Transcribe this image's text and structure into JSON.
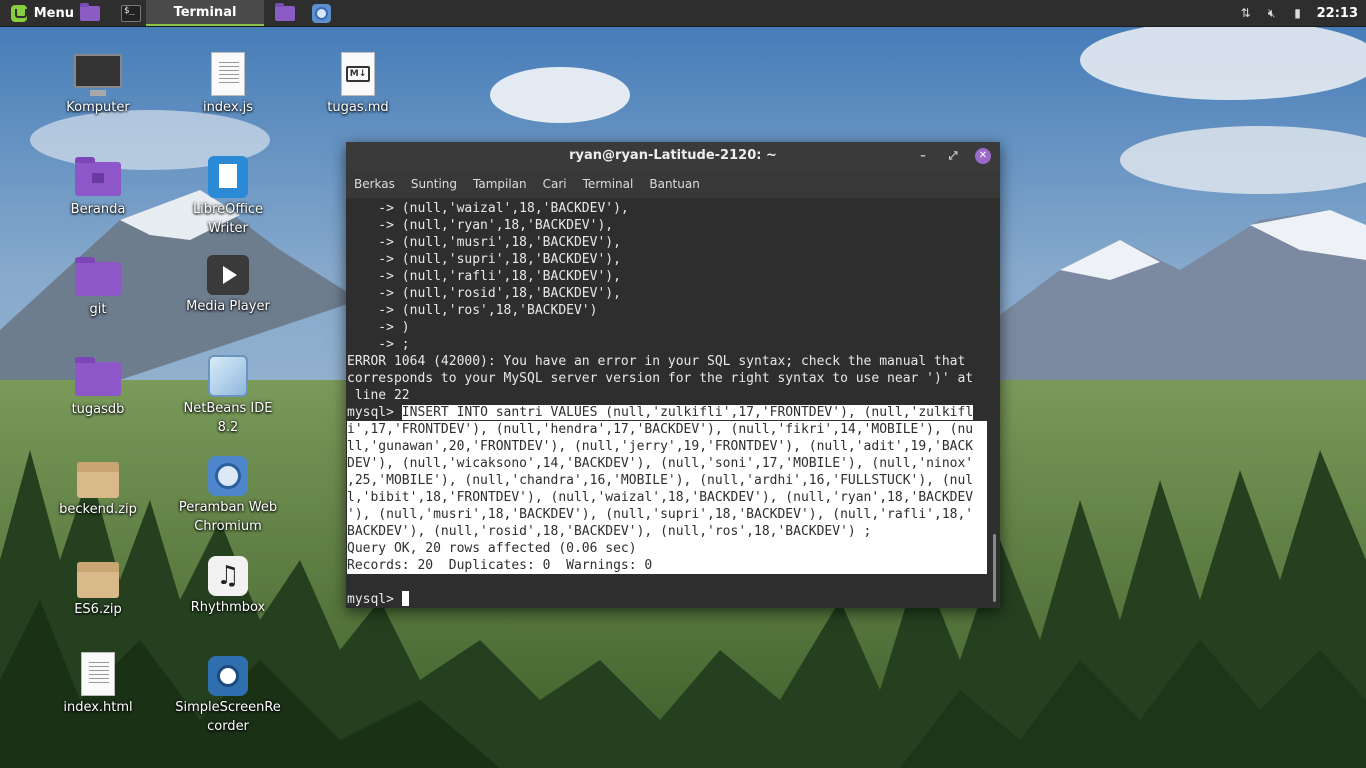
{
  "panel": {
    "menu_label": "Menu",
    "taskbar_item": "Terminal",
    "clock": "22:13",
    "launchers": [
      "folder-icon",
      "terminal-icon",
      "folder-icon",
      "chromium-icon"
    ],
    "term_mini_text": "$_"
  },
  "desktop": {
    "icons": [
      {
        "label": "Komputer",
        "icon": "computer-icon"
      },
      {
        "label": "index.js",
        "icon": "document-icon"
      },
      {
        "label": "tugas.md",
        "icon": "markdown-icon",
        "badge": "M↓"
      },
      {
        "label": "Beranda",
        "icon": "home-folder-icon"
      },
      {
        "label": "LibreOffice Writer",
        "icon": "writer-icon"
      },
      {
        "label": "git",
        "icon": "folder-icon"
      },
      {
        "label": "Media Player",
        "icon": "media-player-icon"
      },
      {
        "label": "tugasdb",
        "icon": "folder-icon"
      },
      {
        "label": "NetBeans IDE 8.2",
        "icon": "netbeans-icon"
      },
      {
        "label": "beckend.zip",
        "icon": "archive-icon"
      },
      {
        "label": "Peramban Web Chromium",
        "icon": "chromium-icon"
      },
      {
        "label": "ES6.zip",
        "icon": "archive-icon"
      },
      {
        "label": "Rhythmbox",
        "icon": "rhythmbox-icon",
        "glyph": "♫"
      },
      {
        "label": "index.html",
        "icon": "document-icon"
      },
      {
        "label": "SimpleScreenRecorder",
        "icon": "screen-recorder-icon"
      }
    ]
  },
  "terminal": {
    "title": "ryan@ryan-Latitude-2120: ~",
    "window_buttons": {
      "minimize": "–",
      "maximize": "⤢",
      "close": "✕"
    },
    "menu": [
      "Berkas",
      "Sunting",
      "Tampilan",
      "Cari",
      "Terminal",
      "Bantuan"
    ],
    "lines": [
      "    -> (null,'waizal',18,'BACKDEV'),",
      "    -> (null,'ryan',18,'BACKDEV'),",
      "    -> (null,'musri',18,'BACKDEV'),",
      "    -> (null,'supri',18,'BACKDEV'),",
      "    -> (null,'rafli',18,'BACKDEV'),",
      "    -> (null,'rosid',18,'BACKDEV'),",
      "    -> (null,'ros',18,'BACKDEV')",
      "    -> )",
      "    -> ;",
      "ERROR 1064 (42000): You have an error in your SQL syntax; check the manual that",
      "corresponds to your MySQL server version for the right syntax to use near ')' at",
      " line 22"
    ],
    "prompt": "mysql> ",
    "selected_lines": [
      "INSERT INTO santri VALUES (null,'zulkifli',17,'FRONTDEV'), (null,'zulkifl",
      "i',17,'FRONTDEV'), (null,'hendra',17,'BACKDEV'), (null,'fikri',14,'MOBILE'), (nu",
      "ll,'gunawan',20,'FRONTDEV'), (null,'jerry',19,'FRONTDEV'), (null,'adit',19,'BACK",
      "DEV'), (null,'wicaksono',14,'BACKDEV'), (null,'soni',17,'MOBILE'), (null,'ninox'",
      ",25,'MOBILE'), (null,'chandra',16,'MOBILE'), (null,'ardhi',16,'FULLSTUCK'), (nul",
      "l,'bibit',18,'FRONTDEV'), (null,'waizal',18,'BACKDEV'), (null,'ryan',18,'BACKDEV",
      "'), (null,'musri',18,'BACKDEV'), (null,'supri',18,'BACKDEV'), (null,'rafli',18,'",
      "BACKDEV'), (null,'rosid',18,'BACKDEV'), (null,'ros',18,'BACKDEV') ;",
      "Query OK, 20 rows affected (0.06 sec)",
      "Records: 20  Duplicates: 0  Warnings: 0"
    ],
    "final_prompt": "mysql> "
  }
}
